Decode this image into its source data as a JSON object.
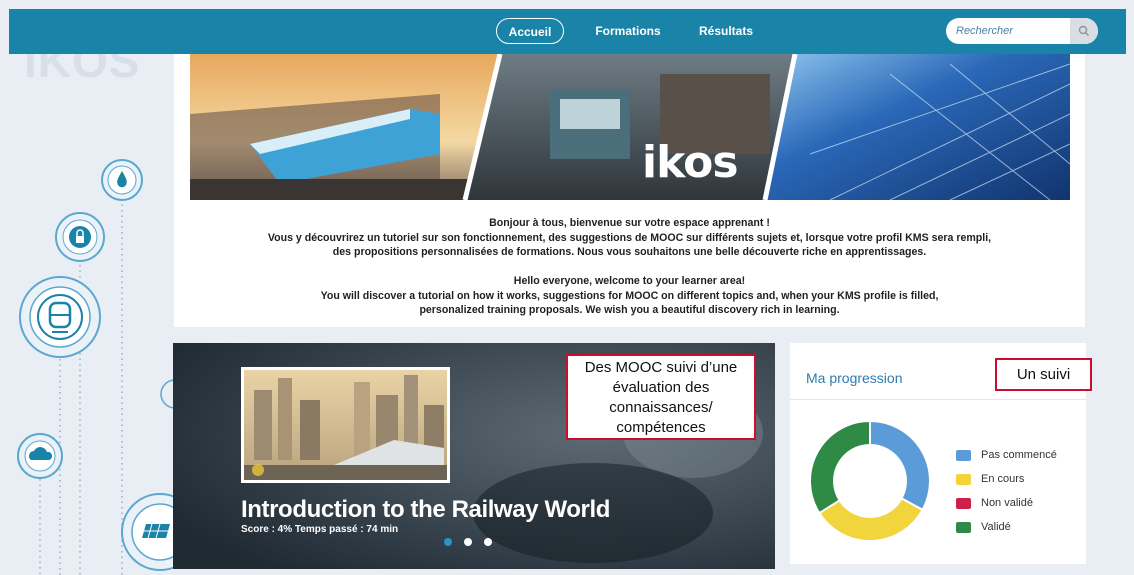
{
  "nav": {
    "items": [
      {
        "label": "Accueil",
        "active": true
      },
      {
        "label": "Formations",
        "active": false
      },
      {
        "label": "Résultats",
        "active": false
      }
    ],
    "search_placeholder": "Rechercher",
    "search_icon": "search-icon"
  },
  "banner": {
    "logo_text": "ikos",
    "welcome_fr": [
      "Bonjour à tous, bienvenue sur votre espace apprenant !",
      "Vous y découvrirez un tutoriel sur son fonctionnement, des suggestions de MOOC sur différents sujets et, lorsque votre profil KMS sera rempli,",
      "des propositions personnalisées de formations. Nous vous souhaitons une belle découverte riche en apprentissages."
    ],
    "welcome_en": [
      "Hello everyone, welcome to your learner area!",
      "You will discover a tutorial on how it works, suggestions for MOOC on different topics and, when your KMS profile is filled,",
      "personalized training proposals. We wish you a beautiful discovery rich in learning."
    ]
  },
  "carousel": {
    "title": "Introduction to the Railway World",
    "meta": "Score : 4% Temps passé : 74 min",
    "slides_count": 3,
    "active_slide": 0
  },
  "annotations": {
    "mooc": "Des MOOC suivi d’une évaluation des connaissances/ compétences",
    "suivi": "Un suivi"
  },
  "progress": {
    "title": "Ma progression",
    "legend": [
      {
        "label": "Pas commencé",
        "color": "#5a9bd8"
      },
      {
        "label": "En cours",
        "color": "#f2d43c"
      },
      {
        "label": "Non validé",
        "color": "#d01f48"
      },
      {
        "label": "Validé",
        "color": "#2f8a46"
      }
    ],
    "chart_data": {
      "type": "pie",
      "donut": true,
      "slices": [
        {
          "label": "Pas commencé",
          "value": 33
        },
        {
          "label": "En cours",
          "value": 33
        },
        {
          "label": "Non validé",
          "value": 0
        },
        {
          "label": "Validé",
          "value": 34
        }
      ]
    }
  },
  "side_icons": [
    "water-drop-icon",
    "lock-icon",
    "train-icon",
    "cloud-icon",
    "solar-panel-icon"
  ]
}
